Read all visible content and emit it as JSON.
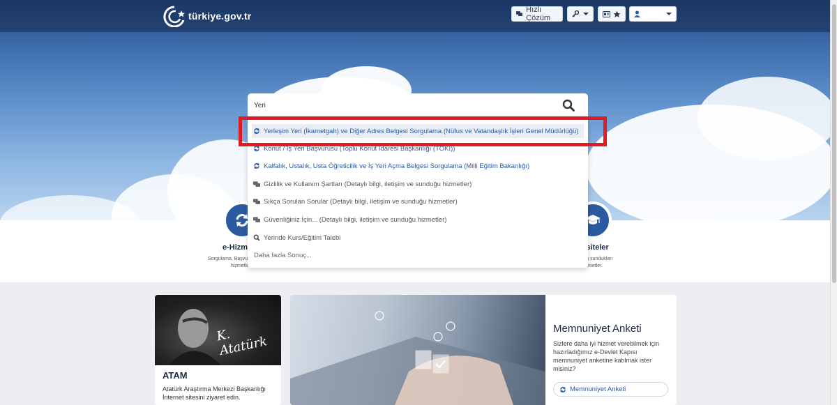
{
  "header": {
    "logo_text": "türkiye.gov.tr",
    "quick_solution_label": "Hızlı Çözüm"
  },
  "search": {
    "value": "Yeri",
    "suggestions": [
      {
        "icon": "refresh-icon",
        "type": "service",
        "label": "Yerleşim Yeri (İkametgah) ve Diğer Adres Belgesi Sorgulama (Nüfus ve Vatandaşlık İşleri Genel Müdürlüğü)",
        "selected": true
      },
      {
        "icon": "refresh-icon",
        "type": "service",
        "label": "Konut / İş Yeri Başvurusu (Toplu Konut İdaresi Başkanlığı (TOKİ))"
      },
      {
        "icon": "refresh-icon",
        "type": "service",
        "label": "Kalfalık, Ustalık, Usta Öğreticilik ve İş Yeri Açma Belgesi Sorgulama (Milli Eğitim Bakanlığı)"
      },
      {
        "icon": "chat-icon",
        "type": "info",
        "label": "Gizlilik ve Kullanım Şartları (Detaylı bilgi, iletişim ve sunduğu hizmetler)"
      },
      {
        "icon": "chat-icon",
        "type": "info",
        "label": "Sıkça Sorulan Sorular (Detaylı bilgi, iletişim ve sunduğu hizmetler)"
      },
      {
        "icon": "chat-icon",
        "type": "info",
        "label": "Güvenliğiniz İçin... (Detaylı bilgi, iletişim ve sunduğu hizmetler)"
      },
      {
        "icon": "search-icon",
        "type": "info",
        "label": "Yerinde Kurs/Eğitim Talebi"
      }
    ],
    "more_results": "Daha fazla Sonuç..."
  },
  "band": {
    "left_title": "e-Hizme",
    "left_desc_line1": "Sorgulama, Başvu",
    "left_desc_line2": "hizmetle",
    "right_title": "ersiteler",
    "right_desc_line1": "lerin sundukları",
    "right_desc_line2": "izmetler."
  },
  "atam": {
    "title": "ATAM",
    "description": "Atatürk Araştırma Merkezi Başkanlığı İnternet sitesini ziyaret edin.",
    "signature": "K. Atatürk"
  },
  "survey": {
    "title": "Memnuniyet Anketi",
    "description": "Sizlere daha iyi hizmet verebilmek için hazırladığımız e-Devlet Kapısı memnuniyet anketine katılmak ister misiniz?",
    "button_label": "Memnuniyet Anketi"
  }
}
